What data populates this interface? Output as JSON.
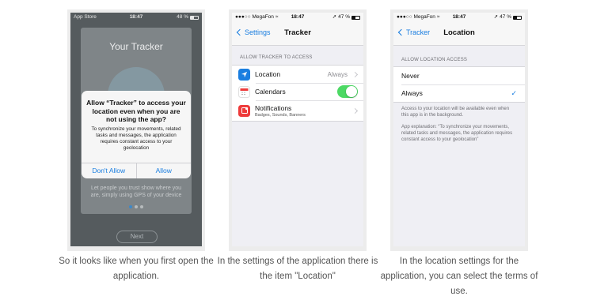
{
  "colors": {
    "ios_blue": "#1a7ee0",
    "toggle_green": "#4cd964",
    "location_icon": "#1a7ee0",
    "notifications_icon": "#ee3b3b",
    "page_dot_active": "#3d88c8"
  },
  "screen1": {
    "status": {
      "carrier": "App Store",
      "time": "18:47",
      "battery": "48 %"
    },
    "onboarding_title": "Your Tracker",
    "onboarding_text": "Let people you trust know where you are, simply using GPS of your device",
    "onboarding_text_visible": "Let people you trust show where you are, simply using GPS of your device",
    "alert": {
      "title": "Allow “Tracker” to access your location even when you are not using the app?",
      "message": "To synchronize your movements, related tasks and messages, the application requires constant access to your geolocation",
      "deny_label": "Don't Allow",
      "allow_label": "Allow"
    },
    "page_dots": 3,
    "active_dot": 1,
    "next_label": "Next"
  },
  "screen2": {
    "status": {
      "carrier": "MegaFon",
      "time": "18:47",
      "battery": "47 %"
    },
    "back_label": "Settings",
    "title": "Tracker",
    "section_header": "ALLOW TRACKER TO ACCESS",
    "rows": [
      {
        "label": "Location",
        "value": "Always",
        "icon": "location-arrow-icon"
      },
      {
        "label": "Calendars",
        "toggle": true,
        "icon": "calendar-icon"
      },
      {
        "label": "Notifications",
        "sublabel": "Badges, Sounds, Banners",
        "icon": "notifications-icon"
      }
    ]
  },
  "screen3": {
    "status": {
      "carrier": "MegaFon",
      "time": "18:47",
      "battery": "47 %"
    },
    "back_label": "Tracker",
    "title": "Location",
    "section_header": "ALLOW LOCATION ACCESS",
    "options": [
      {
        "label": "Never",
        "selected": false
      },
      {
        "label": "Always",
        "selected": true
      }
    ],
    "check_glyph": "✓",
    "footnote1": "Access to your location will be available even when this app is in the background.",
    "footnote2": "App explanation: “To synchronize your movements, related tasks and messages, the application requires constant access to your geolocation”"
  },
  "captions": [
    "So it looks like when you first open the application.",
    "In the settings of the application there is the item \"Location\"",
    "In the location settings for the application, you can select the terms of use."
  ]
}
